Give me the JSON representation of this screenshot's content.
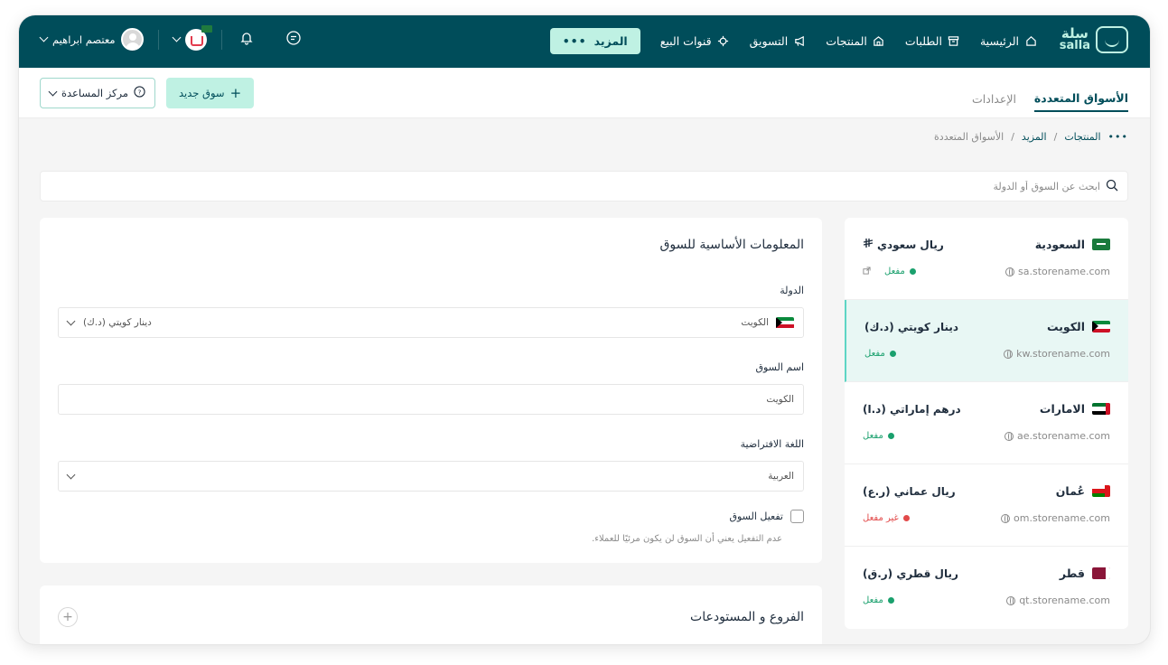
{
  "topbar": {
    "logo_ar": "سلة",
    "logo_en": "salla",
    "nav": [
      {
        "label": "الرئيسية",
        "icon": "home-icon"
      },
      {
        "label": "الطلبات",
        "icon": "orders-box-icon"
      },
      {
        "label": "المنتجات",
        "icon": "products-icon"
      },
      {
        "label": "التسويق",
        "icon": "megaphone-icon"
      },
      {
        "label": "قنوات البيع",
        "icon": "channels-icon"
      }
    ],
    "more_label": "المزيد",
    "user_name": "معتصم ابراهيم"
  },
  "subheader": {
    "tabs": [
      {
        "label": "الأسواق المتعددة",
        "active": true
      },
      {
        "label": "الإعدادات",
        "active": false
      }
    ],
    "new_market_label": "سوق جديد",
    "help_center_label": "مركز المساعدة"
  },
  "breadcrumb": {
    "items": [
      "المنتجات",
      "المزيد"
    ],
    "current": "الأسواق المتعددة"
  },
  "search": {
    "placeholder": "ابحث عن السوق أو الدولة"
  },
  "markets": [
    {
      "country": "السعودية",
      "currency": "ريال سعودي",
      "domain": "sa.storename.com",
      "status": "مفعل",
      "active": true,
      "flag": "sa",
      "selected": false,
      "external_link": true
    },
    {
      "country": "الكويت",
      "currency": "دينار كويتي (د.ك)",
      "domain": "kw.storename.com",
      "status": "مفعل",
      "active": true,
      "flag": "kw",
      "selected": true
    },
    {
      "country": "الامارات",
      "currency": "درهم إماراتي (د.ا)",
      "domain": "ae.storename.com",
      "status": "مفعل",
      "active": true,
      "flag": "ae",
      "selected": false
    },
    {
      "country": "عُمان",
      "currency": "ريال عماني (ر.ع)",
      "domain": "om.storename.com",
      "status": "غير مفعل",
      "active": false,
      "flag": "om",
      "selected": false
    },
    {
      "country": "قطر",
      "currency": "ريال قطري (ر.ق)",
      "domain": "qt.storename.com",
      "status": "مفعل",
      "active": true,
      "flag": "qa",
      "selected": false
    }
  ],
  "form": {
    "title": "المعلومات الأساسية للسوق",
    "country_label": "الدولة",
    "country_value": "الكويت",
    "currency_value": "دينار كويتي (د.ك)",
    "market_name_label": "اسم السوق",
    "market_name_value": "الكويت",
    "language_label": "اللغة الافتراضية",
    "language_value": "العربية",
    "activate_label": "تفعيل السوق",
    "activate_checked": false,
    "activate_help": "عدم التفعيل يعني أن السوق لن يكون مرئيًا للعملاء."
  },
  "branches": {
    "title": "الفروع و المستودعات"
  },
  "colors": {
    "primary": "#004d5a",
    "accent": "#bff1e3",
    "active_status": "#1aa06d",
    "inactive_status": "#e24a4a"
  }
}
